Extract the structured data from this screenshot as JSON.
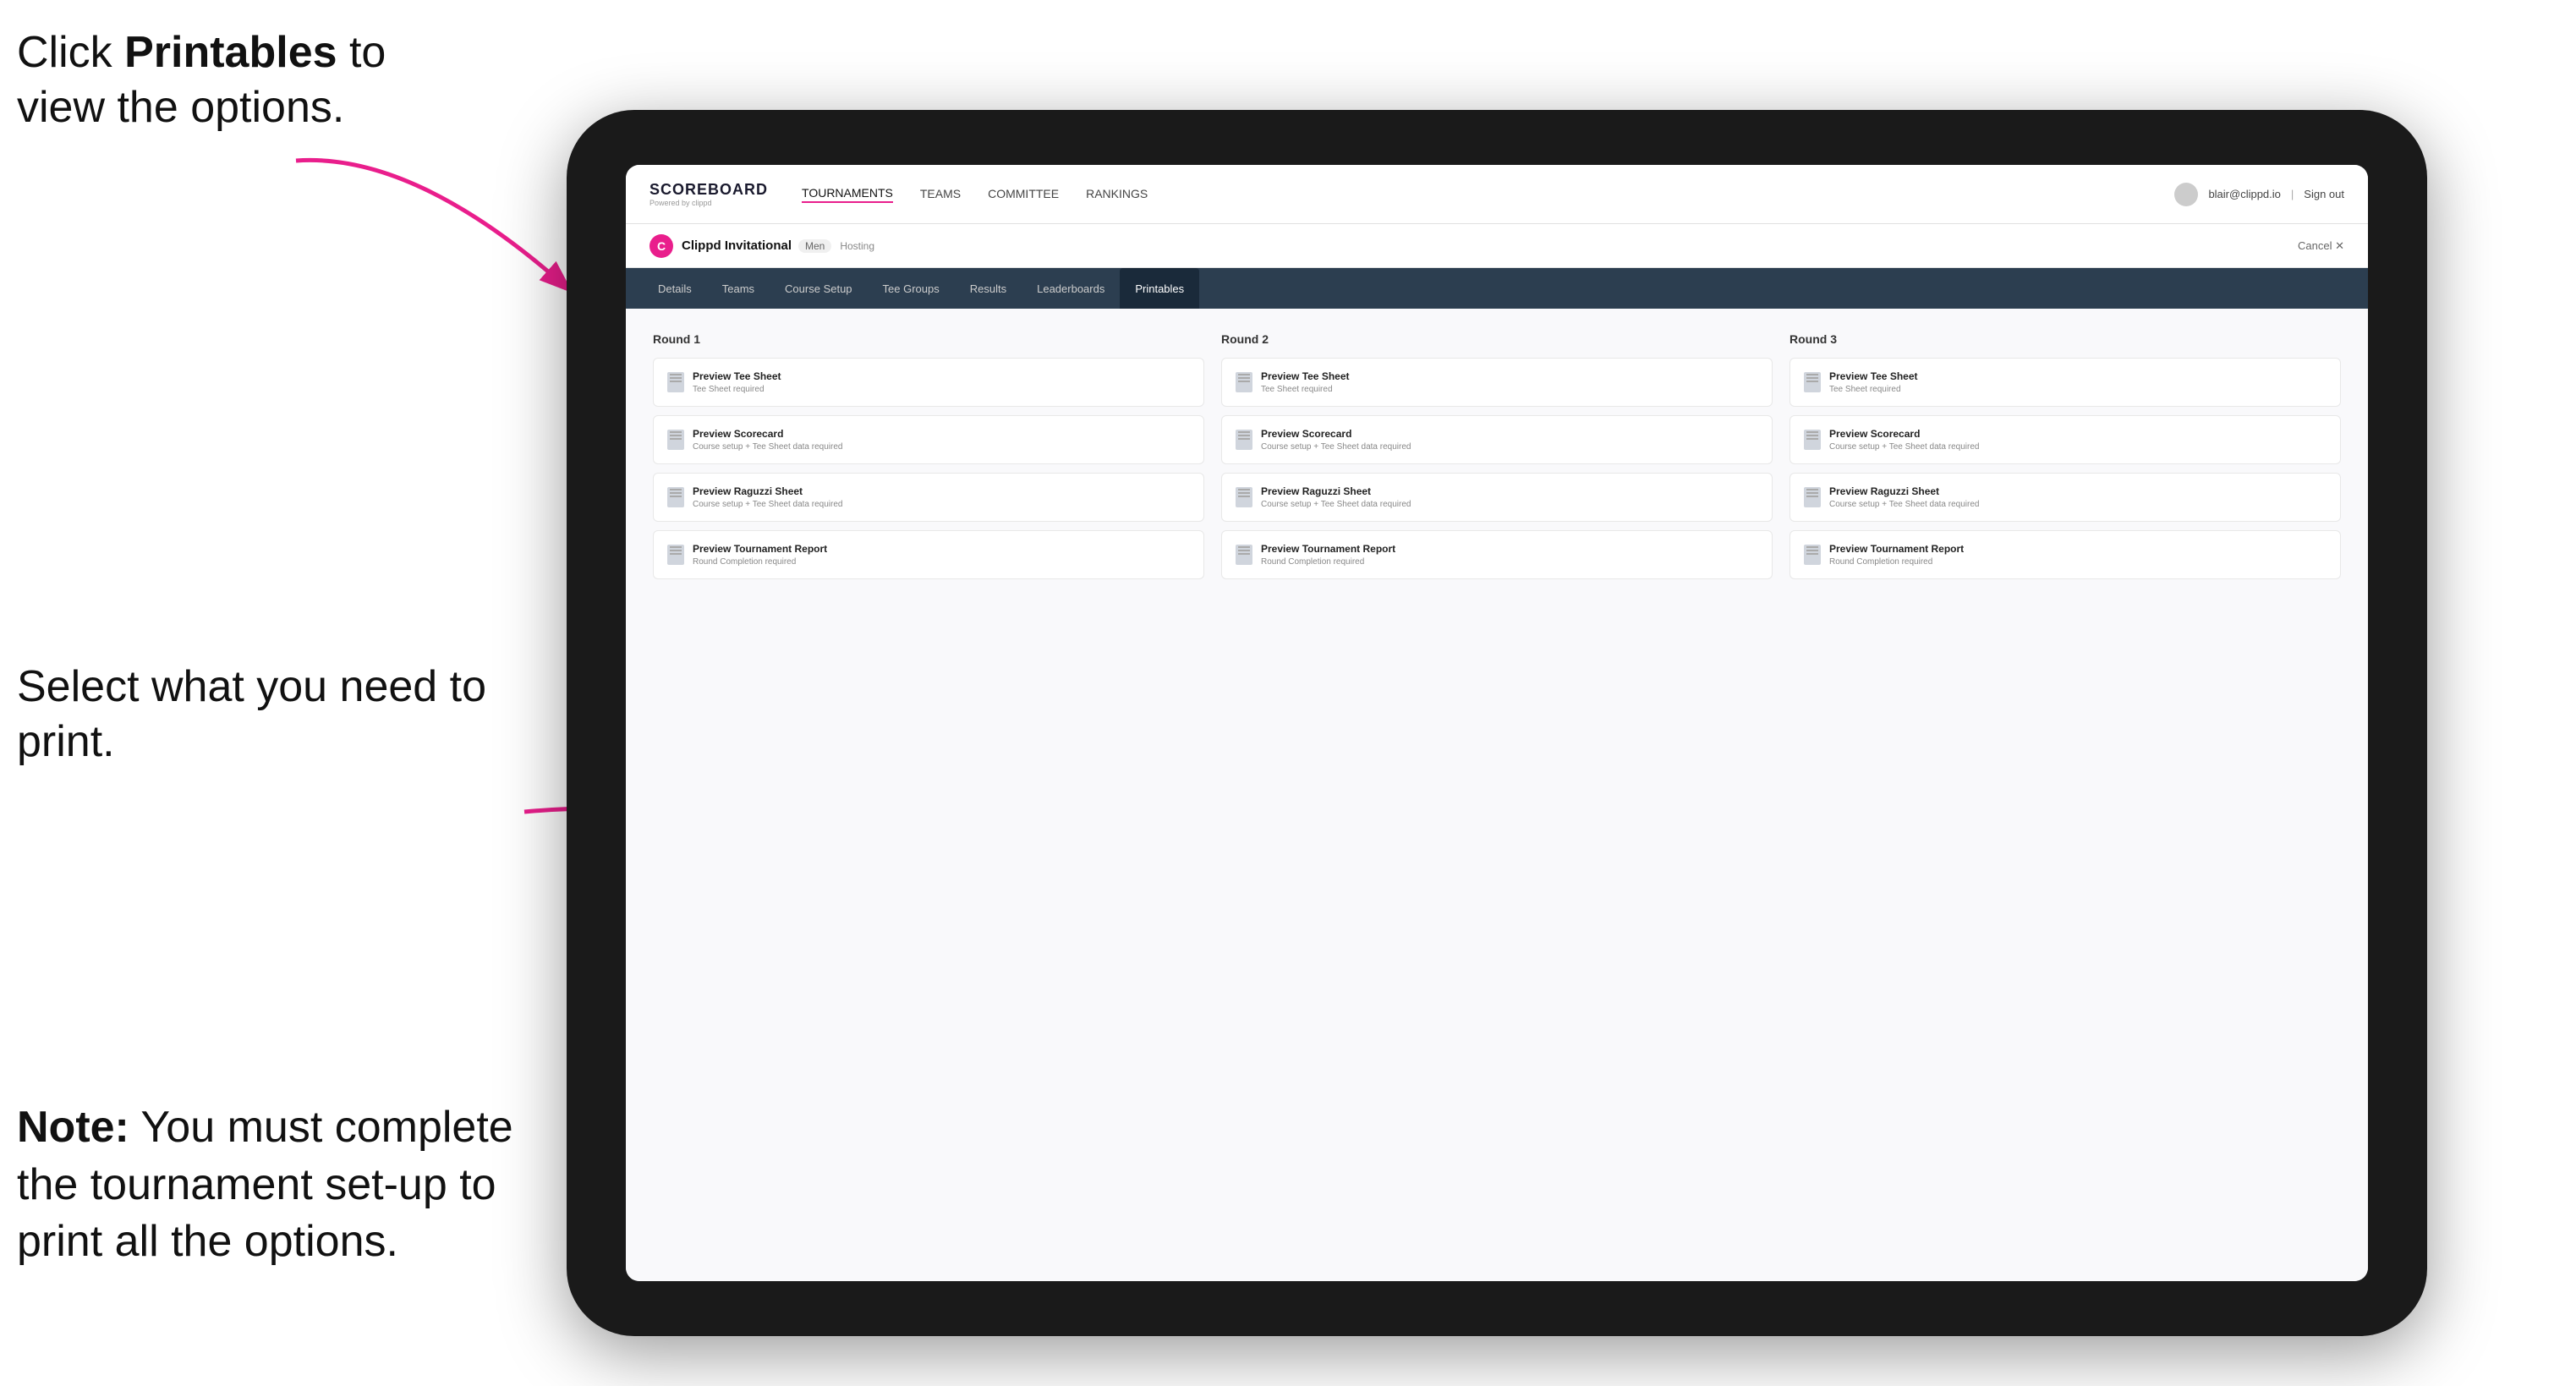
{
  "instructions": {
    "top": {
      "line1": "Click ",
      "bold": "Printables",
      "line2": " to",
      "line3": "view the options."
    },
    "middle": {
      "text": "Select what you need to print."
    },
    "bottom": {
      "bold": "Note:",
      "text": " You must complete the tournament set-up to print all the options."
    }
  },
  "app": {
    "logo": "SCOREBOARD",
    "logo_sub": "Powered by clippd",
    "nav": {
      "items": [
        "TOURNAMENTS",
        "TEAMS",
        "COMMITTEE",
        "RANKINGS"
      ]
    },
    "user": {
      "email": "blair@clippd.io",
      "sign_out": "Sign out"
    },
    "tournament": {
      "name": "Clippd Invitational",
      "badge": "Men",
      "status": "Hosting",
      "cancel": "Cancel ✕"
    },
    "tabs": [
      "Details",
      "Teams",
      "Course Setup",
      "Tee Groups",
      "Results",
      "Leaderboards",
      "Printables"
    ],
    "active_tab": "Printables",
    "rounds": [
      {
        "title": "Round 1",
        "items": [
          {
            "title": "Preview Tee Sheet",
            "subtitle": "Tee Sheet required"
          },
          {
            "title": "Preview Scorecard",
            "subtitle": "Course setup + Tee Sheet data required"
          },
          {
            "title": "Preview Raguzzi Sheet",
            "subtitle": "Course setup + Tee Sheet data required"
          },
          {
            "title": "Preview Tournament Report",
            "subtitle": "Round Completion required"
          }
        ]
      },
      {
        "title": "Round 2",
        "items": [
          {
            "title": "Preview Tee Sheet",
            "subtitle": "Tee Sheet required"
          },
          {
            "title": "Preview Scorecard",
            "subtitle": "Course setup + Tee Sheet data required"
          },
          {
            "title": "Preview Raguzzi Sheet",
            "subtitle": "Course setup + Tee Sheet data required"
          },
          {
            "title": "Preview Tournament Report",
            "subtitle": "Round Completion required"
          }
        ]
      },
      {
        "title": "Round 3",
        "items": [
          {
            "title": "Preview Tee Sheet",
            "subtitle": "Tee Sheet required"
          },
          {
            "title": "Preview Scorecard",
            "subtitle": "Course setup + Tee Sheet data required"
          },
          {
            "title": "Preview Raguzzi Sheet",
            "subtitle": "Course setup + Tee Sheet data required"
          },
          {
            "title": "Preview Tournament Report",
            "subtitle": "Round Completion required"
          }
        ]
      }
    ]
  }
}
